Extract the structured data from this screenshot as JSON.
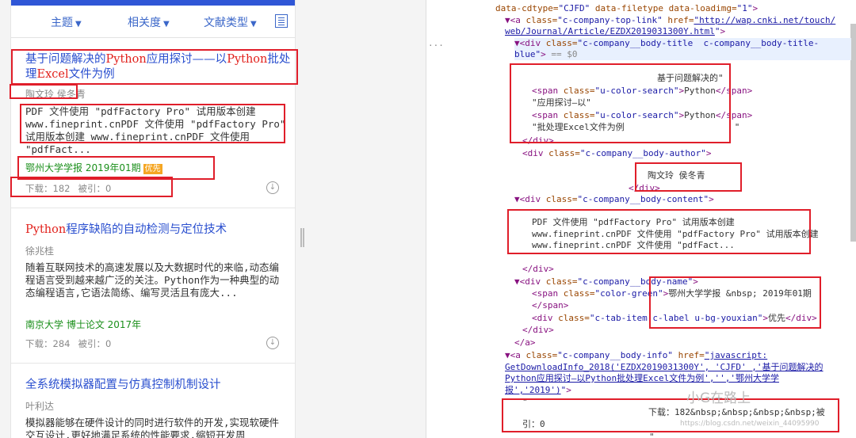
{
  "mobile": {
    "filters": [
      {
        "label": "主题"
      },
      {
        "label": "相关度"
      },
      {
        "label": "文献类型"
      }
    ],
    "articles": [
      {
        "title_parts": [
          "基于问题解决的",
          "Python",
          "应用探讨——以",
          "Python",
          "批处",
          "理",
          "Excel",
          "文件为例"
        ],
        "author": "陶文玲 侯冬青",
        "body": "PDF 文件使用 \"pdfFactory Pro\" 试用版本创建 www.fineprint.cnPDF 文件使用 \"pdfFactory Pro\" 试用版本创建 www.fineprint.cnPDF 文件使用 \"pdfFact...",
        "source": "鄂州大学学报  2019年01期",
        "badge": "优先",
        "downloads": "下载：182",
        "citations": "被引：0"
      },
      {
        "title_parts": [
          "Python",
          "程序缺陷的自动检测与定位技术"
        ],
        "author": "徐兆桂",
        "body": "随着互联网技术的高速发展以及大数据时代的来临,动态编程语言受到越来越广泛的关注。Python作为一种典型的动态编程语言,它语法简练、编写灵活且有庞大...",
        "source": "南京大学  博士论文  2017年",
        "downloads": "下载：284",
        "citations": "被引：0"
      },
      {
        "title_parts": [
          "全系统模拟器配置与仿真控制机制设计"
        ],
        "author": "叶利达",
        "body": "模拟器能够在硬件设计的同时进行软件的开发,实现软硬件交互设计,更好地满足系统的性能要求,缩短开发周"
      }
    ]
  },
  "devtools": {
    "lines": [
      "data-cdtype=\"CJFD\" data-filetype data-loadimg=\"1\">",
      "<a class=\"c-company-top-link\" href=\"http://wap.cnki.net/touch/",
      "web/Journal/Article/EZDX2019031300Y.html\">",
      "<div class=\"c-company__body-title  c-company__body-title-",
      "blue\"> == $0",
      "基于问题解决的\"",
      "<span class=\"u-color-search\">Python</span>",
      "\"应用探讨—以\"",
      "<span class=\"u-color-search\">Python</span>",
      "\"批处理Excel文件为例                     \"",
      "</div>",
      "<div class=\"c-company__body-author\">",
      "陶文玲 侯冬青",
      "</div>",
      "<div class=\"c-company__body-content\">",
      "PDF 文件使用 \"pdfFactory Pro\" 试用版本创建",
      "www.fineprint.cnPDF 文件使用 \"pdfFactory Pro\" 试用版本创建",
      "www.fineprint.cnPDF 文件使用 \"pdfFact...",
      "</div>",
      "<div class=\"c-company__body-name\">",
      "<span class=\"color-green\">鄂州大学学报 &nbsp; 2019年01期",
      "</span>",
      "<div class=\"c-tab-item c-label u-bg-youxian\">优先</div>",
      "</div>",
      "</a>",
      "<a class=\"c-company__body-info\" href=\"javascript:",
      "GetDownloadInfo_2018('EZDX2019031300Y', 'CJFD' ,'基于问题解决的",
      "Python应用探讨—以Python批处理Excel文件为例','','鄂州大学学",
      "报','2019')\">",
      "\"",
      "下载：182&nbsp;&nbsp;&nbsp;&nbsp;被",
      "引：0",
      "\""
    ],
    "selected_marker": "...",
    "watermark": "小G在路上",
    "watermark_url": "https://blog.csdn.net/weixin_44095990"
  },
  "colors": {
    "accent_blue": "#2f56d6",
    "title_blue": "#2a4fcf",
    "highlight_red": "#e2211c",
    "source_green": "#1b8f1b",
    "badge_orange": "#f5a623",
    "annotation_red": "#e01e2a"
  }
}
